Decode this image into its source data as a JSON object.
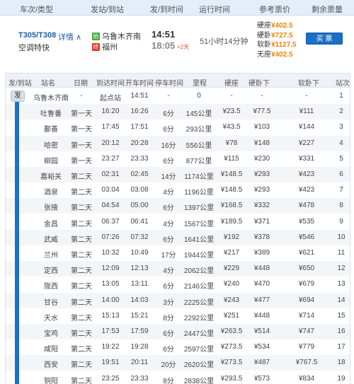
{
  "header": {
    "col_train": "车次/类型",
    "col_stations": "发站/到站",
    "col_times": "发/到时间",
    "col_duration": "运行时间",
    "col_price": "参考票价",
    "col_tickets": "剩余票量"
  },
  "train": {
    "number": "T305/T308",
    "detail_label": "详情",
    "type": "空调特快",
    "from_station": "乌鲁木齐南",
    "to_station": "福州",
    "from_icon_text": "始",
    "to_icon_text": "终",
    "dep_time": "14:51",
    "arr_time": "18:05",
    "day_offset": "+2天",
    "duration": "51小时14分钟",
    "prices": [
      {
        "label": "硬座",
        "value": "¥402.5"
      },
      {
        "label": "硬卧",
        "value": "¥727.5"
      },
      {
        "label": "软卧",
        "value": "¥1127.5"
      },
      {
        "label": "无座",
        "value": "¥402.5"
      }
    ],
    "buy_label": "买 票"
  },
  "schedule": {
    "columns": [
      "发/到站",
      "站名",
      "日期",
      "到达时间",
      "开车时间",
      "停车时间",
      "里程",
      "硬座",
      "硬卧下",
      "软卧下",
      "站次"
    ],
    "badge": "发",
    "rows": [
      [
        "乌鲁木齐南",
        "-",
        "起点站",
        "14:51",
        "-",
        "0",
        "-",
        "-",
        "-",
        "1"
      ],
      [
        "吐鲁番",
        "第一天",
        "16:20",
        "16:26",
        "6分",
        "145公里",
        "¥23.5",
        "¥77.5",
        "¥111",
        "2"
      ],
      [
        "鄯善",
        "第一天",
        "17:45",
        "17:51",
        "6分",
        "293公里",
        "¥43.5",
        "¥103",
        "¥144",
        "3"
      ],
      [
        "哈密",
        "第一天",
        "20:12",
        "20:28",
        "16分",
        "556公里",
        "¥78",
        "¥148",
        "¥227",
        "4"
      ],
      [
        "柳园",
        "第一天",
        "23:27",
        "23:33",
        "6分",
        "877公里",
        "¥115",
        "¥230",
        "¥331",
        "5"
      ],
      [
        "嘉峪关",
        "第二天",
        "02:31",
        "02:45",
        "14分",
        "1174公里",
        "¥148.5",
        "¥293",
        "¥423",
        "6"
      ],
      [
        "酒泉",
        "第二天",
        "03:04",
        "03:08",
        "4分",
        "1196公里",
        "¥148.5",
        "¥293",
        "¥423",
        "7"
      ],
      [
        "张掖",
        "第二天",
        "04:54",
        "05:00",
        "6分",
        "1397公里",
        "¥168.5",
        "¥332",
        "¥478",
        "8"
      ],
      [
        "金昌",
        "第二天",
        "06:37",
        "06:41",
        "4分",
        "1567公里",
        "¥189.5",
        "¥371",
        "¥535",
        "9"
      ],
      [
        "武威",
        "第二天",
        "07:26",
        "07:32",
        "6分",
        "1641公里",
        "¥192",
        "¥378",
        "¥546",
        "10"
      ],
      [
        "兰州",
        "第二天",
        "10:32",
        "10:49",
        "17分",
        "1944公里",
        "¥217",
        "¥389",
        "¥621",
        "11"
      ],
      [
        "定西",
        "第二天",
        "12:09",
        "12:13",
        "4分",
        "2062公里",
        "¥229",
        "¥448",
        "¥650",
        "12"
      ],
      [
        "陇西",
        "第二天",
        "13:05",
        "13:11",
        "6分",
        "2146公里",
        "¥240",
        "¥470",
        "¥679",
        "13"
      ],
      [
        "甘谷",
        "第二天",
        "14:00",
        "14:03",
        "3分",
        "2225公里",
        "¥243",
        "¥477",
        "¥694",
        "14"
      ],
      [
        "天水",
        "第二天",
        "15:13",
        "15:21",
        "8分",
        "2292公里",
        "¥251",
        "¥448",
        "¥714",
        "15"
      ],
      [
        "宝鸡",
        "第二天",
        "17:53",
        "17:59",
        "6分",
        "2447公里",
        "¥263.5",
        "¥514",
        "¥747",
        "16"
      ],
      [
        "咸阳",
        "第二天",
        "19:22",
        "19:28",
        "6分",
        "2597公里",
        "¥273.5",
        "¥534",
        "¥779",
        "17"
      ],
      [
        "西安",
        "第二天",
        "19:51",
        "20:11",
        "20分",
        "2620公里",
        "¥273.5",
        "¥487",
        "¥767.5",
        "18"
      ],
      [
        "铜阳",
        "第二天",
        "23:25",
        "23:33",
        "8分",
        "2838公里",
        "¥293.5",
        "¥573",
        "¥834",
        "19"
      ]
    ]
  }
}
